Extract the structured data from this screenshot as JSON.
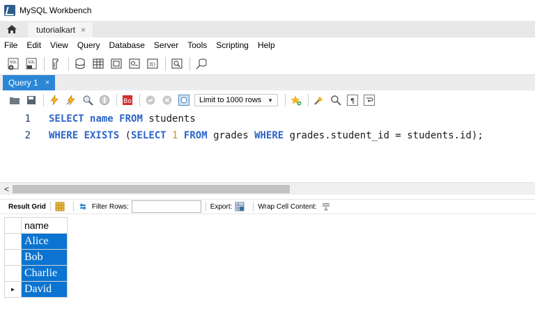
{
  "window": {
    "title": "MySQL Workbench"
  },
  "connection_tab": {
    "label": "tutorialkart",
    "close": "×"
  },
  "menu": [
    "File",
    "Edit",
    "View",
    "Query",
    "Database",
    "Server",
    "Tools",
    "Scripting",
    "Help"
  ],
  "main_toolbar": {
    "icons": [
      "new-sql-tab-icon",
      "open-sql-script-icon",
      "inspector-icon",
      "create-schema-icon",
      "create-table-icon",
      "create-view-icon",
      "create-procedure-icon",
      "create-function-icon",
      "search-table-data-icon",
      "reconnect-icon"
    ]
  },
  "query_tab": {
    "label": "Query 1",
    "close": "×"
  },
  "editor_toolbar": {
    "limit_label": "Limit to 1000 rows",
    "icons": [
      "open-file-icon",
      "save-icon",
      "execute-icon",
      "execute-current-icon",
      "explain-icon",
      "stop-icon",
      "toggle-error-icon",
      "commit-icon",
      "rollback-icon",
      "autocommit-icon",
      "add-snippet-icon",
      "beautify-icon",
      "find-icon",
      "invisible-chars-icon",
      "wrap-lines-icon"
    ]
  },
  "editor": {
    "lines": [
      {
        "num": "1",
        "tokens": [
          {
            "t": "SELECT ",
            "c": "kw"
          },
          {
            "t": "name ",
            "c": "kw"
          },
          {
            "t": "FROM ",
            "c": "kw"
          },
          {
            "t": "students",
            "c": "tx"
          }
        ]
      },
      {
        "num": "2",
        "tokens": [
          {
            "t": "WHERE ",
            "c": "kw"
          },
          {
            "t": "EXISTS ",
            "c": "kw"
          },
          {
            "t": "(",
            "c": "tx"
          },
          {
            "t": "SELECT ",
            "c": "kw"
          },
          {
            "t": "1 ",
            "c": "num"
          },
          {
            "t": "FROM ",
            "c": "kw"
          },
          {
            "t": "grades ",
            "c": "tx"
          },
          {
            "t": "WHERE ",
            "c": "kw"
          },
          {
            "t": "grades.student_id = students.id);",
            "c": "tx"
          }
        ]
      }
    ]
  },
  "result_toolbar": {
    "result_grid": "Result Grid",
    "filter_rows": "Filter Rows:",
    "filter_value": "",
    "export": "Export:",
    "wrap": "Wrap Cell Content:"
  },
  "result_grid": {
    "columns": [
      "name"
    ],
    "rows": [
      "Alice",
      "Bob",
      "Charlie",
      "David"
    ],
    "current_row_marker": "▸"
  },
  "colors": {
    "accent": "#2b86d6",
    "selection": "#0b74d1",
    "keyword": "#2c65c9",
    "number": "#d98a1e"
  }
}
